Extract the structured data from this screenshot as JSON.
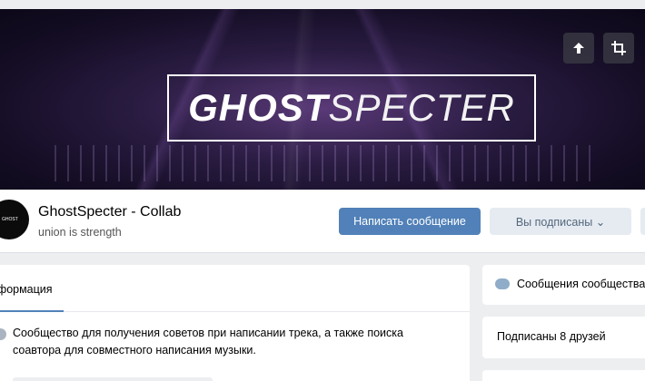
{
  "cover": {
    "logo_bold": "GHOST",
    "logo_thin": "SPECTER",
    "buttons": [
      {
        "icon": "upload-arrow-icon"
      },
      {
        "icon": "crop-icon"
      }
    ]
  },
  "group": {
    "avatar_text": "GHOST",
    "name": "GhostSpecter - Collab",
    "status": "union is strength",
    "message_button": "Написать сообщение",
    "subscribed_button": "Вы подписаны",
    "subscribed_chevron": "⌄"
  },
  "info": {
    "tab_label": "нформация",
    "description": "Сообщество для получения советов при написании трека, а также поиска соавтора для совместного написания музыки."
  },
  "sidebar": {
    "messages_label": "Сообщения сообщества",
    "friends_label": "Подписаны 8 друзей"
  },
  "colors": {
    "accent": "#5181b8",
    "page_bg": "#edeef0",
    "secondary_button_bg": "#e5ebf1"
  }
}
